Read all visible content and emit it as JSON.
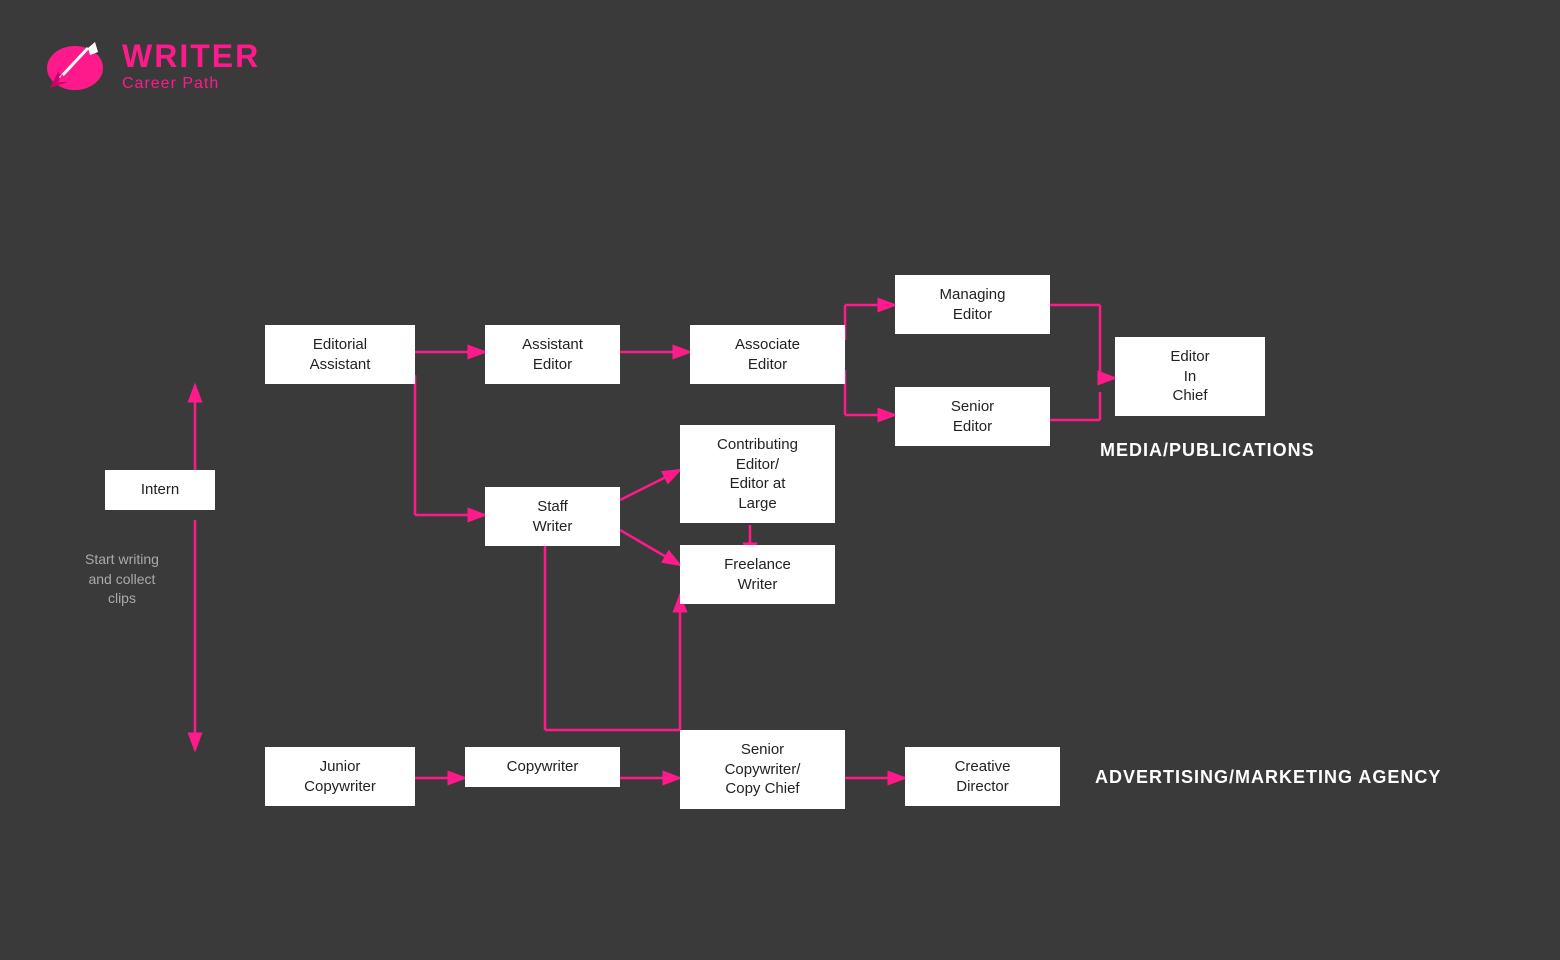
{
  "header": {
    "writer_label": "WRITER",
    "career_label": "Career Path"
  },
  "nodes": {
    "intern": {
      "label": "Intern"
    },
    "start_note": {
      "label": "Start writing\nand collect\nclips"
    },
    "editorial_assistant": {
      "label": "Editorial\nAssistant"
    },
    "assistant_editor": {
      "label": "Assistant\nEditor"
    },
    "staff_writer": {
      "label": "Staff\nWriter"
    },
    "associate_editor": {
      "label": "Associate\nEditor"
    },
    "contributing_editor": {
      "label": "Contributing\nEditor/\nEditor at\nLarge"
    },
    "freelance_writer": {
      "label": "Freelance\nWriter"
    },
    "managing_editor": {
      "label": "Managing\nEditor"
    },
    "senior_editor": {
      "label": "Senior\nEditor"
    },
    "editor_in_chief": {
      "label": "Editor\nIn\nChief"
    },
    "junior_copywriter": {
      "label": "Junior\nCopywriter"
    },
    "copywriter": {
      "label": "Copywriter"
    },
    "senior_copywriter": {
      "label": "Senior\nCopywriter/\nCopy Chief"
    },
    "creative_director": {
      "label": "Creative\nDirector"
    }
  },
  "section_labels": {
    "media": "MEDIA/PUBLICATIONS",
    "advertising": "ADVERTISING/MARKETING AGENCY"
  },
  "colors": {
    "arrow": "#ff1a8c",
    "bg": "#3a3a3a",
    "box_bg": "#ffffff",
    "text_dark": "#222222",
    "label_color": "#aaaaaa",
    "section_color": "#ffffff"
  }
}
